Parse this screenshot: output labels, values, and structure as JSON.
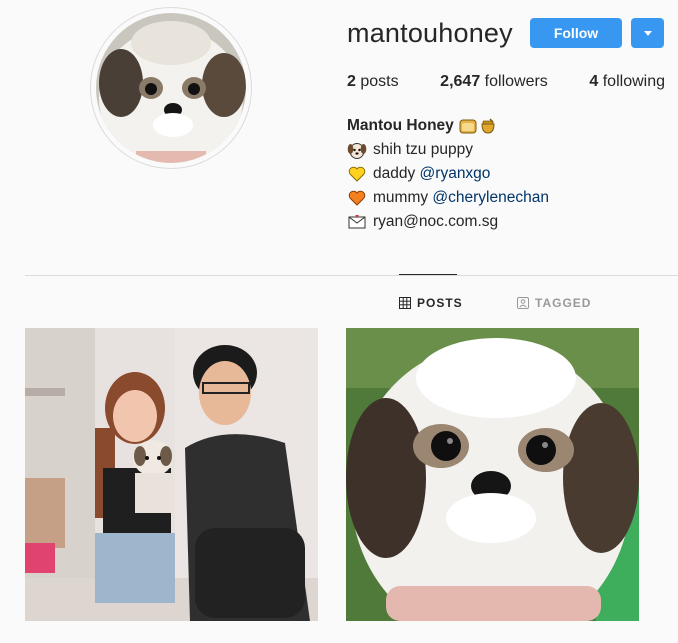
{
  "profile": {
    "username": "mantouhoney",
    "follow_label": "Follow",
    "stats": {
      "posts_count": "2",
      "posts_label": "posts",
      "followers_count": "2,647",
      "followers_label": "followers",
      "following_count": "4",
      "following_label": "following"
    },
    "bio": {
      "name": "Mantou Honey",
      "lines": [
        {
          "icon": "dog-face-icon",
          "text": "shih tzu puppy",
          "link": ""
        },
        {
          "icon": "yellow-heart-icon",
          "text": "daddy ",
          "link": "@ryanxgo"
        },
        {
          "icon": "orange-heart-icon",
          "text": "mummy ",
          "link": "@cherylenechan"
        },
        {
          "icon": "envelope-icon",
          "text": "ryan@noc.com.sg",
          "link": ""
        }
      ]
    }
  },
  "tabs": [
    {
      "label": "POSTS",
      "icon": "grid-icon",
      "active": true
    },
    {
      "label": "TAGGED",
      "icon": "tag-person-icon",
      "active": false
    }
  ],
  "posts": [
    {
      "icon": "couple-with-puppy-photo"
    },
    {
      "icon": "puppy-closeup-photo"
    }
  ],
  "colors": {
    "accent": "#3897f0",
    "background": "#fafafa",
    "link": "#003569",
    "border": "#dbdbdb"
  }
}
